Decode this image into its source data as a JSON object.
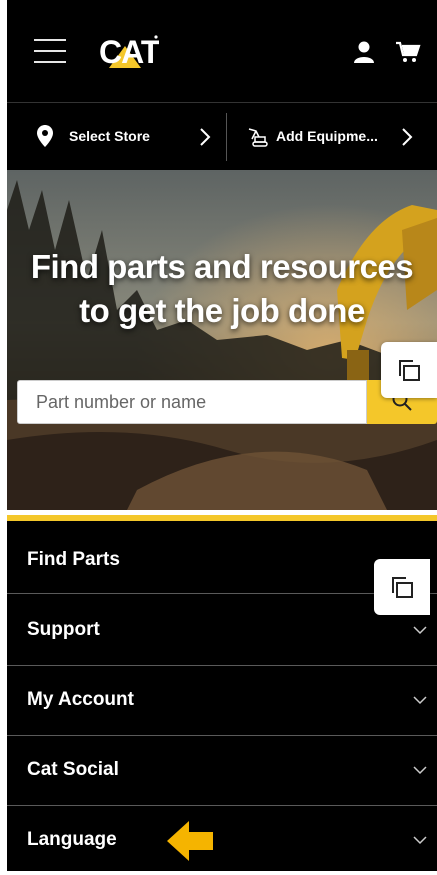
{
  "header": {
    "logo_text": "CAT",
    "icons": [
      "menu-icon",
      "user-icon",
      "cart-icon"
    ]
  },
  "store_bar": {
    "store_label": "Select Store",
    "equipment_label": "Add Equipme..."
  },
  "hero": {
    "headline_line1": "Find parts and resources",
    "headline_line2": "to get the job done",
    "search_placeholder": "Part number or name"
  },
  "menu": {
    "items": [
      {
        "label": "Find Parts"
      },
      {
        "label": "Support"
      },
      {
        "label": "My Account"
      },
      {
        "label": "Cat Social"
      },
      {
        "label": "Language"
      }
    ]
  },
  "colors": {
    "accent": "#f4c72a",
    "background": "#000000",
    "pointer_arrow": "#f5b400"
  }
}
